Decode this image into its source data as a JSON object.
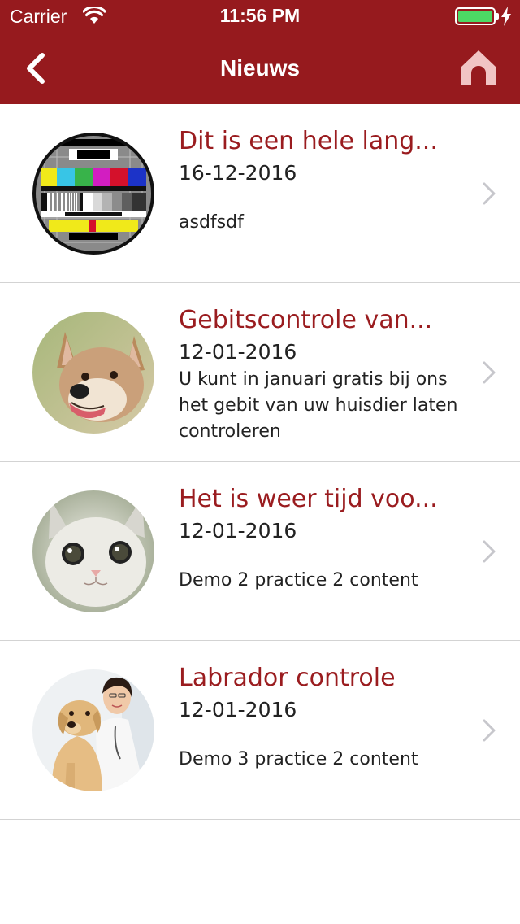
{
  "status_bar": {
    "carrier": "Carrier",
    "time": "11:56 PM",
    "battery_level": 1.0,
    "battery_color": "#4cd964"
  },
  "header": {
    "title": "Nieuws",
    "back_icon": "chevron-left-icon",
    "home_icon": "home-icon",
    "color": "#961a1e"
  },
  "news": [
    {
      "title": "Dit is een hele lang...",
      "date": "16-12-2016",
      "description": "asdfsdf",
      "image": "tv-test-pattern"
    },
    {
      "title": "Gebitscontrole van...",
      "date": "12-01-2016",
      "description": "U kunt in januari gratis bij ons het gebit van uw huisdier laten controleren",
      "image": "dog"
    },
    {
      "title": "Het is weer tijd voo...",
      "date": "12-01-2016",
      "description": "Demo 2 practice 2 content",
      "image": "cat"
    },
    {
      "title": "Labrador controle",
      "date": "12-01-2016",
      "description": "Demo 3 practice 2 content",
      "image": "vet-with-labrador"
    }
  ]
}
